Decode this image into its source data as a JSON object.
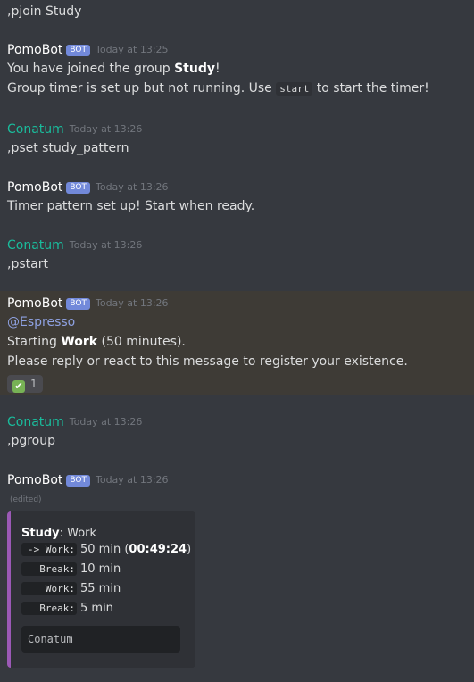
{
  "messages": {
    "m0": {
      "text": ",pjoin Study"
    },
    "m1": {
      "author": "PomoBot",
      "badge": "BOT",
      "time": "Today at 13:25",
      "l1_a": "You have joined the group ",
      "l1_b": "Study",
      "l1_c": "!",
      "l2_a": "Group timer is set up but not running. Use ",
      "l2_code": "start",
      "l2_c": " to start the timer!"
    },
    "m2": {
      "author": "Conatum",
      "time": "Today at 13:26",
      "text": ",pset study_pattern"
    },
    "m3": {
      "author": "PomoBot",
      "badge": "BOT",
      "time": "Today at 13:26",
      "text": "Timer pattern set up! Start when ready."
    },
    "m4": {
      "author": "Conatum",
      "time": "Today at 13:26",
      "text": ",pstart"
    },
    "m5": {
      "author": "PomoBot",
      "badge": "BOT",
      "time": "Today at 13:26",
      "mention": "@Espresso",
      "l2_a": "Starting ",
      "l2_b": "Work",
      "l2_c": " (50 minutes).",
      "l3": "Please reply or react to this message to register your existence.",
      "reaction_emoji": "✔",
      "reaction_count": "1"
    },
    "m6": {
      "author": "Conatum",
      "time": "Today at 13:26",
      "text": ",pgroup"
    },
    "m7": {
      "author": "PomoBot",
      "badge": "BOT",
      "time": "Today at 13:26",
      "edited": "(edited)",
      "embed": {
        "title_bold": "Study",
        "title_rest": ": Work",
        "rows": [
          {
            "code": "-> Work:",
            "value": "50 min (",
            "value_bold": "00:49:24",
            "value_end": ")"
          },
          {
            "code": "Break:",
            "value": "10 min",
            "value_bold": "",
            "value_end": ""
          },
          {
            "code": "Work:",
            "value": "55 min",
            "value_bold": "",
            "value_end": ""
          },
          {
            "code": "Break:",
            "value": "5 min",
            "value_bold": "",
            "value_end": ""
          }
        ],
        "members": "Conatum"
      }
    }
  },
  "colors": {
    "background": "#36393f",
    "bot_badge": "#7289da",
    "user_name": "#1abc9c",
    "embed_accent": "#9b59b6",
    "mention": "#8ea1e1"
  }
}
